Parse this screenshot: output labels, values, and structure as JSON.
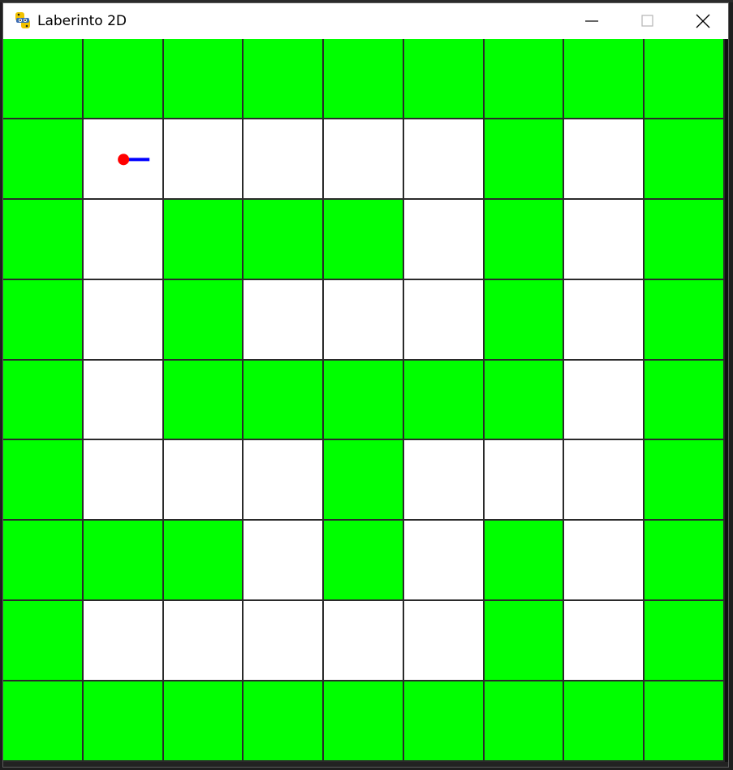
{
  "window": {
    "title": "Laberinto 2D",
    "icon": "python-logo-icon"
  },
  "titlebar_buttons": {
    "minimize_icon": "minimize-icon",
    "maximize_icon": "maximize-icon",
    "close_icon": "close-icon"
  },
  "maze": {
    "rows": 9,
    "cols": 9,
    "wall_color": "#00ff00",
    "path_color": "#ffffff",
    "grid_line_color": "#2a2a2a",
    "grid": [
      [
        1,
        1,
        1,
        1,
        1,
        1,
        1,
        1,
        1
      ],
      [
        1,
        0,
        0,
        0,
        0,
        0,
        1,
        0,
        1
      ],
      [
        1,
        0,
        1,
        1,
        1,
        0,
        1,
        0,
        1
      ],
      [
        1,
        0,
        1,
        0,
        0,
        0,
        1,
        0,
        1
      ],
      [
        1,
        0,
        1,
        1,
        1,
        1,
        1,
        0,
        1
      ],
      [
        1,
        0,
        0,
        0,
        1,
        0,
        0,
        0,
        1
      ],
      [
        1,
        1,
        1,
        0,
        1,
        0,
        1,
        0,
        1
      ],
      [
        1,
        0,
        0,
        0,
        0,
        0,
        1,
        0,
        1
      ],
      [
        1,
        1,
        1,
        1,
        1,
        1,
        1,
        1,
        1
      ]
    ]
  },
  "player": {
    "row": 1,
    "col": 1,
    "facing": "right",
    "body_color": "#ff0000",
    "direction_color": "#0000ff"
  }
}
